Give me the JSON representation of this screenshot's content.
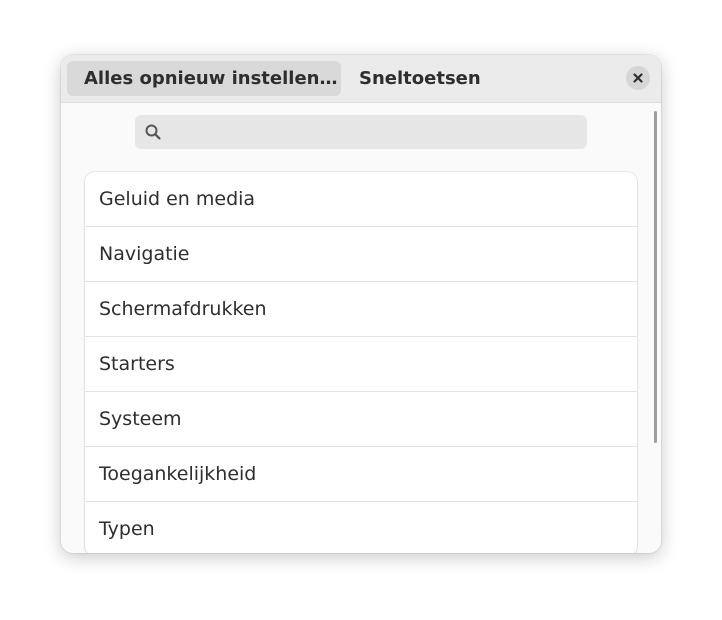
{
  "header": {
    "reset_button_label": "Alles opnieuw instellen…",
    "title": "Sneltoetsen",
    "close_icon": "close-icon"
  },
  "search": {
    "placeholder": "",
    "value": "",
    "icon": "search-icon"
  },
  "categories": [
    {
      "label": "Geluid en media"
    },
    {
      "label": "Navigatie"
    },
    {
      "label": "Schermafdrukken"
    },
    {
      "label": "Starters"
    },
    {
      "label": "Systeem"
    },
    {
      "label": "Toegankelijkheid"
    },
    {
      "label": "Typen"
    }
  ],
  "colors": {
    "headerbar": "#ebebeb",
    "window": "#fafafa",
    "text": "#2e2e2e"
  }
}
